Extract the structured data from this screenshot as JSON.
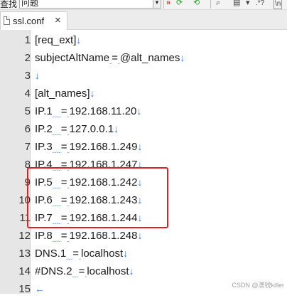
{
  "toolbar": {
    "find_label": "查找",
    "find_value": "问题",
    "dropdown_icon": "chevron-down-icon",
    "nav_glyph": "»",
    "find_next_glyph": "⟳",
    "find_prev_glyph": "⟲",
    "regex_glyph": ".*?",
    "case_glyph": "\\n"
  },
  "tab": {
    "label": "ssl.conf",
    "close": "×"
  },
  "editor": {
    "lines": [
      {
        "num": "1",
        "text": "[req_ext]",
        "eol": "↓"
      },
      {
        "num": "2",
        "text": "subjectAltName·=·@alt_names",
        "eol": "↓"
      },
      {
        "num": "3",
        "text": "",
        "eol": "↓"
      },
      {
        "num": "4",
        "text": "[alt_names]",
        "eol": "↓"
      },
      {
        "num": "5",
        "text": "IP.1····=·192.168.11.20",
        "eol": "↓"
      },
      {
        "num": "6",
        "text": "IP.2····=·127.0.0.1",
        "eol": "↓"
      },
      {
        "num": "7",
        "text": "IP.3····=·192.168.1.249",
        "eol": "↓"
      },
      {
        "num": "8",
        "text": "IP.4····=·192.168.1.247",
        "eol": "↓"
      },
      {
        "num": "9",
        "text": "IP.5····=·192.168.1.242",
        "eol": "↓"
      },
      {
        "num": "10",
        "text": "IP.6····=·192.168.1.243",
        "eol": "↓"
      },
      {
        "num": "11",
        "text": "IP.7····=·192.168.1.244",
        "eol": "↓"
      },
      {
        "num": "12",
        "text": "IP.8····=·192.168.1.248",
        "eol": "↓"
      },
      {
        "num": "13",
        "text": "DNS.1···=·localhost",
        "eol": "↓"
      },
      {
        "num": "14",
        "text": "#DNS.2···=·localhost",
        "eol": "↓"
      },
      {
        "num": "15",
        "text": "",
        "eol": "←"
      }
    ],
    "highlight_color": "#e02020"
  },
  "watermark": "CSDN @潇锐killer"
}
